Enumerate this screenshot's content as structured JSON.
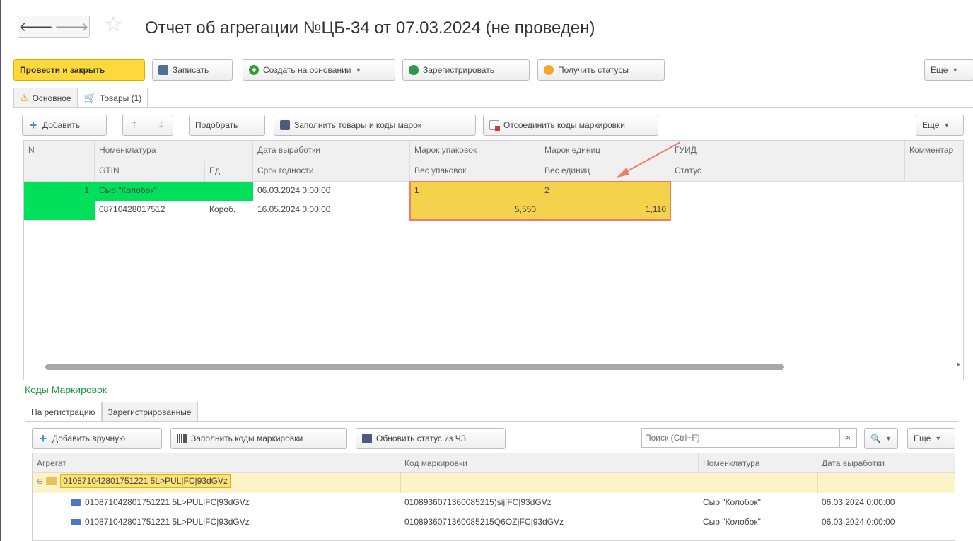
{
  "header": {
    "back_label": "🡐",
    "forward_label": "🡒",
    "title": "Отчет об агрегации №ЦБ-34 от 07.03.2024 (не проведен)"
  },
  "toolbar": {
    "post_close": "Провести и закрыть",
    "save": "Записать",
    "create_based": "Создать на основании",
    "register": "Зарегистрировать",
    "get_statuses": "Получить статусы",
    "more": "Еще"
  },
  "tabs": {
    "main": "Основное",
    "goods": "Товары (1)"
  },
  "goods_toolbar": {
    "add": "Добавить",
    "up": "🡑",
    "down": "🡓",
    "select": "Подобрать",
    "fill_goods_codes": "Заполнить товары и коды марок",
    "detach_codes": "Отсоединить коды маркировки",
    "more": "Еще"
  },
  "goods_grid": {
    "headers_row1": [
      "N",
      "Номенклатура",
      "Дата выработки",
      "Марок упаковок",
      "Марок единиц",
      "ГУИД",
      "Комментар"
    ],
    "headers_row2": [
      "GTIN",
      "Ед",
      "Срок годности",
      "Вес упаковок",
      "Вес единиц",
      "Статус"
    ],
    "row1": {
      "n": "1",
      "name": "Сыр \"Колобок\"",
      "prod_date": "06.03.2024 0:00:00",
      "pack_marks": "1",
      "unit_marks": "2"
    },
    "row2": {
      "gtin": "08710428017512",
      "unit": "Короб.",
      "expiry": "16.05.2024 0:00:00",
      "pack_weight": "5,550",
      "unit_weight": "1,110"
    }
  },
  "codes_section": {
    "title": "Коды Маркировок",
    "tab_registering": "На регистрацию",
    "tab_registered": "Зарегистрированные",
    "add_manual": "Добавить вручную",
    "fill_codes": "Заполнить коды маркировки",
    "update_status": "Обновить статус из ЧЗ",
    "search_placeholder": "Поиск (Ctrl+F)",
    "search_clear": "×",
    "search_icon": "🔍",
    "more": "Еще",
    "headers": [
      "Агрегат",
      "Код маркировки",
      "Номенклатура",
      "Дата выработки"
    ],
    "group_row": {
      "aggregate": "010871042801751221 5L>PUL|FC|93dGVz"
    },
    "rows": [
      {
        "aggregate": "010871042801751221 5L>PUL|FC|93dGVz",
        "code": "0108936071360085215)sij|FC|93dGVz",
        "name": "Сыр \"Колобок\"",
        "date": "06.03.2024 0:00:00"
      },
      {
        "aggregate": "010871042801751221 5L>PUL|FC|93dGVz",
        "code": "0108936071360085215Q6OZ|FC|93dGVz",
        "name": "Сыр \"Колобок\"",
        "date": "06.03.2024 0:00:00"
      }
    ]
  }
}
